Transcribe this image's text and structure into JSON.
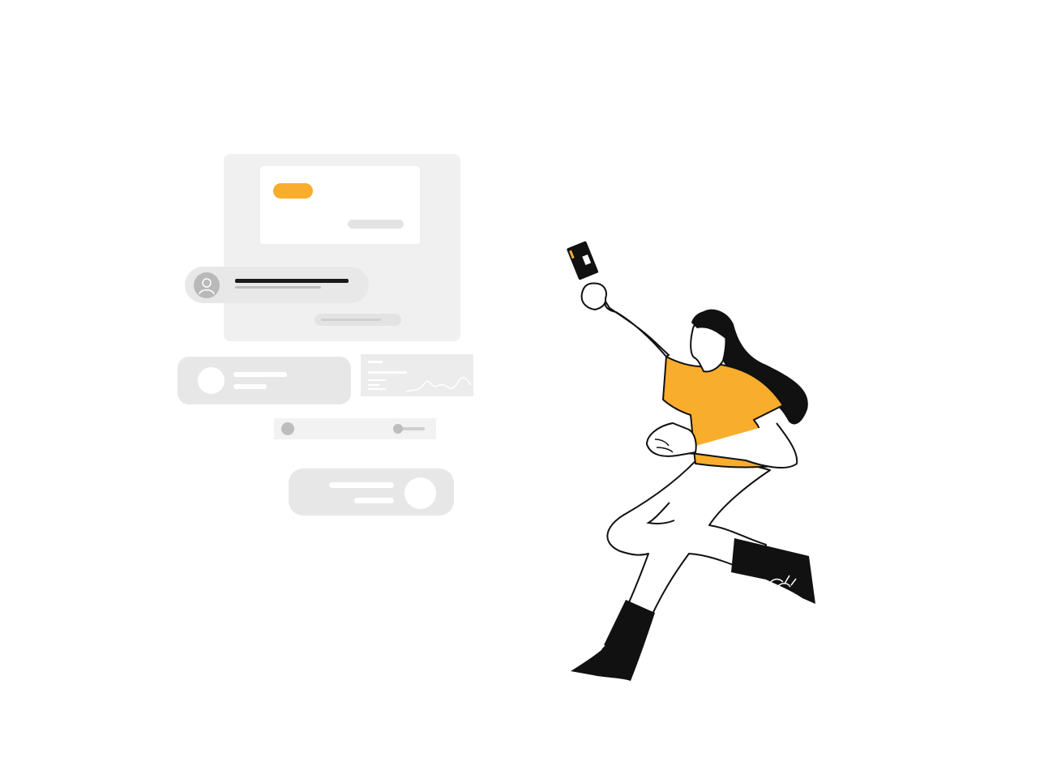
{
  "colors": {
    "accent": "#f9ad2c",
    "ink": "#111111",
    "panel": "#f0f0f0",
    "card": "#e7e7e7"
  },
  "illustration": {
    "subject": "person-holding-credit-card",
    "icons": [
      "user-icon",
      "credit-card-icon",
      "sparkline-icon"
    ]
  }
}
